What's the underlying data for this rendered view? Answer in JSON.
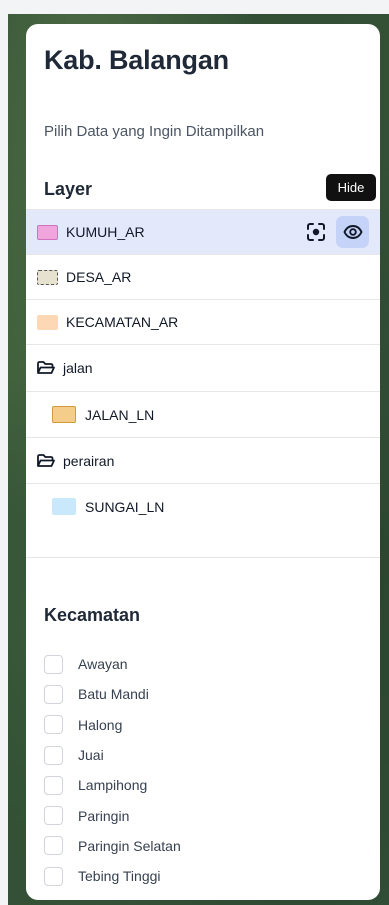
{
  "panel": {
    "title": "Kab. Balangan",
    "subtitle": "Pilih Data yang Ingin Ditampilkan"
  },
  "layer_section": {
    "title": "Layer",
    "tooltip": "Hide",
    "items": [
      {
        "label": "KUMUH_AR",
        "swatch": "#f0a6dd",
        "border": "#d271c0",
        "dashed": false,
        "active": true
      },
      {
        "label": "DESA_AR",
        "swatch": "#e6e2cf",
        "border": "#555555",
        "dashed": true,
        "active": false
      },
      {
        "label": "KECAMATAN_AR",
        "swatch": "#fcd9b4",
        "border": "#fcd9b4",
        "dashed": false,
        "active": false
      },
      {
        "label": "jalan",
        "group": true
      },
      {
        "label": "JALAN_LN",
        "swatch": "#f5cd8a",
        "border": "#d29a3c",
        "dashed": false,
        "active": false,
        "indent": true
      },
      {
        "label": "perairan",
        "group": true
      },
      {
        "label": "SUNGAI_LN",
        "swatch": "#c9e8fb",
        "border": "#c9e8fb",
        "dashed": false,
        "active": false,
        "indent": true
      }
    ]
  },
  "kecamatan_section": {
    "title": "Kecamatan",
    "options": [
      "Awayan",
      "Batu Mandi",
      "Halong",
      "Juai",
      "Lampihong",
      "Paringin",
      "Paringin Selatan",
      "Tebing Tinggi"
    ]
  },
  "colors": {
    "accent": "#1d4ed8",
    "active_row": "#e3e9fb",
    "eye_button": "#c4d3f7"
  },
  "icons": {
    "focus": "focus-icon",
    "visibility": "eye-icon",
    "group": "folder-open-icon"
  }
}
